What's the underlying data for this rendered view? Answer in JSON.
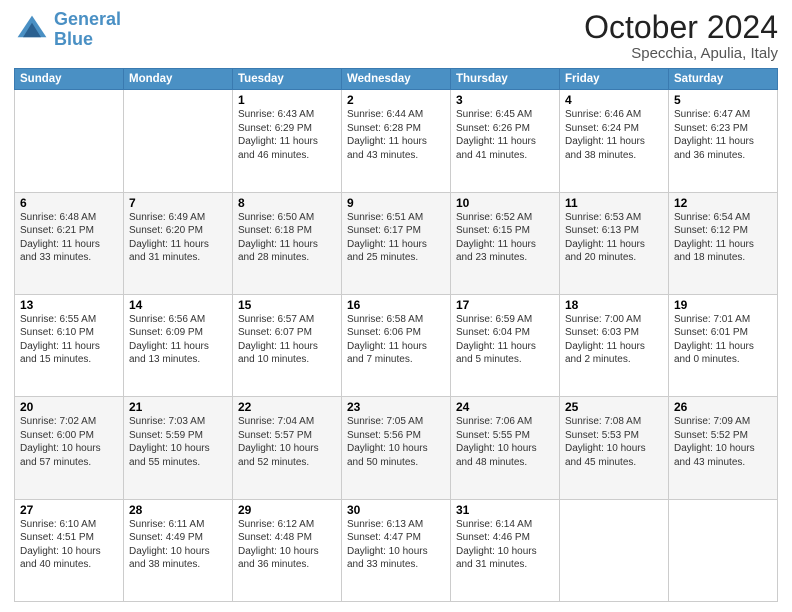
{
  "header": {
    "logo_general": "General",
    "logo_blue": "Blue",
    "title": "October 2024",
    "subtitle": "Specchia, Apulia, Italy"
  },
  "columns": [
    "Sunday",
    "Monday",
    "Tuesday",
    "Wednesday",
    "Thursday",
    "Friday",
    "Saturday"
  ],
  "rows": [
    [
      {
        "day": "",
        "detail": ""
      },
      {
        "day": "",
        "detail": ""
      },
      {
        "day": "1",
        "detail": "Sunrise: 6:43 AM\nSunset: 6:29 PM\nDaylight: 11 hours\nand 46 minutes."
      },
      {
        "day": "2",
        "detail": "Sunrise: 6:44 AM\nSunset: 6:28 PM\nDaylight: 11 hours\nand 43 minutes."
      },
      {
        "day": "3",
        "detail": "Sunrise: 6:45 AM\nSunset: 6:26 PM\nDaylight: 11 hours\nand 41 minutes."
      },
      {
        "day": "4",
        "detail": "Sunrise: 6:46 AM\nSunset: 6:24 PM\nDaylight: 11 hours\nand 38 minutes."
      },
      {
        "day": "5",
        "detail": "Sunrise: 6:47 AM\nSunset: 6:23 PM\nDaylight: 11 hours\nand 36 minutes."
      }
    ],
    [
      {
        "day": "6",
        "detail": "Sunrise: 6:48 AM\nSunset: 6:21 PM\nDaylight: 11 hours\nand 33 minutes."
      },
      {
        "day": "7",
        "detail": "Sunrise: 6:49 AM\nSunset: 6:20 PM\nDaylight: 11 hours\nand 31 minutes."
      },
      {
        "day": "8",
        "detail": "Sunrise: 6:50 AM\nSunset: 6:18 PM\nDaylight: 11 hours\nand 28 minutes."
      },
      {
        "day": "9",
        "detail": "Sunrise: 6:51 AM\nSunset: 6:17 PM\nDaylight: 11 hours\nand 25 minutes."
      },
      {
        "day": "10",
        "detail": "Sunrise: 6:52 AM\nSunset: 6:15 PM\nDaylight: 11 hours\nand 23 minutes."
      },
      {
        "day": "11",
        "detail": "Sunrise: 6:53 AM\nSunset: 6:13 PM\nDaylight: 11 hours\nand 20 minutes."
      },
      {
        "day": "12",
        "detail": "Sunrise: 6:54 AM\nSunset: 6:12 PM\nDaylight: 11 hours\nand 18 minutes."
      }
    ],
    [
      {
        "day": "13",
        "detail": "Sunrise: 6:55 AM\nSunset: 6:10 PM\nDaylight: 11 hours\nand 15 minutes."
      },
      {
        "day": "14",
        "detail": "Sunrise: 6:56 AM\nSunset: 6:09 PM\nDaylight: 11 hours\nand 13 minutes."
      },
      {
        "day": "15",
        "detail": "Sunrise: 6:57 AM\nSunset: 6:07 PM\nDaylight: 11 hours\nand 10 minutes."
      },
      {
        "day": "16",
        "detail": "Sunrise: 6:58 AM\nSunset: 6:06 PM\nDaylight: 11 hours\nand 7 minutes."
      },
      {
        "day": "17",
        "detail": "Sunrise: 6:59 AM\nSunset: 6:04 PM\nDaylight: 11 hours\nand 5 minutes."
      },
      {
        "day": "18",
        "detail": "Sunrise: 7:00 AM\nSunset: 6:03 PM\nDaylight: 11 hours\nand 2 minutes."
      },
      {
        "day": "19",
        "detail": "Sunrise: 7:01 AM\nSunset: 6:01 PM\nDaylight: 11 hours\nand 0 minutes."
      }
    ],
    [
      {
        "day": "20",
        "detail": "Sunrise: 7:02 AM\nSunset: 6:00 PM\nDaylight: 10 hours\nand 57 minutes."
      },
      {
        "day": "21",
        "detail": "Sunrise: 7:03 AM\nSunset: 5:59 PM\nDaylight: 10 hours\nand 55 minutes."
      },
      {
        "day": "22",
        "detail": "Sunrise: 7:04 AM\nSunset: 5:57 PM\nDaylight: 10 hours\nand 52 minutes."
      },
      {
        "day": "23",
        "detail": "Sunrise: 7:05 AM\nSunset: 5:56 PM\nDaylight: 10 hours\nand 50 minutes."
      },
      {
        "day": "24",
        "detail": "Sunrise: 7:06 AM\nSunset: 5:55 PM\nDaylight: 10 hours\nand 48 minutes."
      },
      {
        "day": "25",
        "detail": "Sunrise: 7:08 AM\nSunset: 5:53 PM\nDaylight: 10 hours\nand 45 minutes."
      },
      {
        "day": "26",
        "detail": "Sunrise: 7:09 AM\nSunset: 5:52 PM\nDaylight: 10 hours\nand 43 minutes."
      }
    ],
    [
      {
        "day": "27",
        "detail": "Sunrise: 6:10 AM\nSunset: 4:51 PM\nDaylight: 10 hours\nand 40 minutes."
      },
      {
        "day": "28",
        "detail": "Sunrise: 6:11 AM\nSunset: 4:49 PM\nDaylight: 10 hours\nand 38 minutes."
      },
      {
        "day": "29",
        "detail": "Sunrise: 6:12 AM\nSunset: 4:48 PM\nDaylight: 10 hours\nand 36 minutes."
      },
      {
        "day": "30",
        "detail": "Sunrise: 6:13 AM\nSunset: 4:47 PM\nDaylight: 10 hours\nand 33 minutes."
      },
      {
        "day": "31",
        "detail": "Sunrise: 6:14 AM\nSunset: 4:46 PM\nDaylight: 10 hours\nand 31 minutes."
      },
      {
        "day": "",
        "detail": ""
      },
      {
        "day": "",
        "detail": ""
      }
    ]
  ]
}
